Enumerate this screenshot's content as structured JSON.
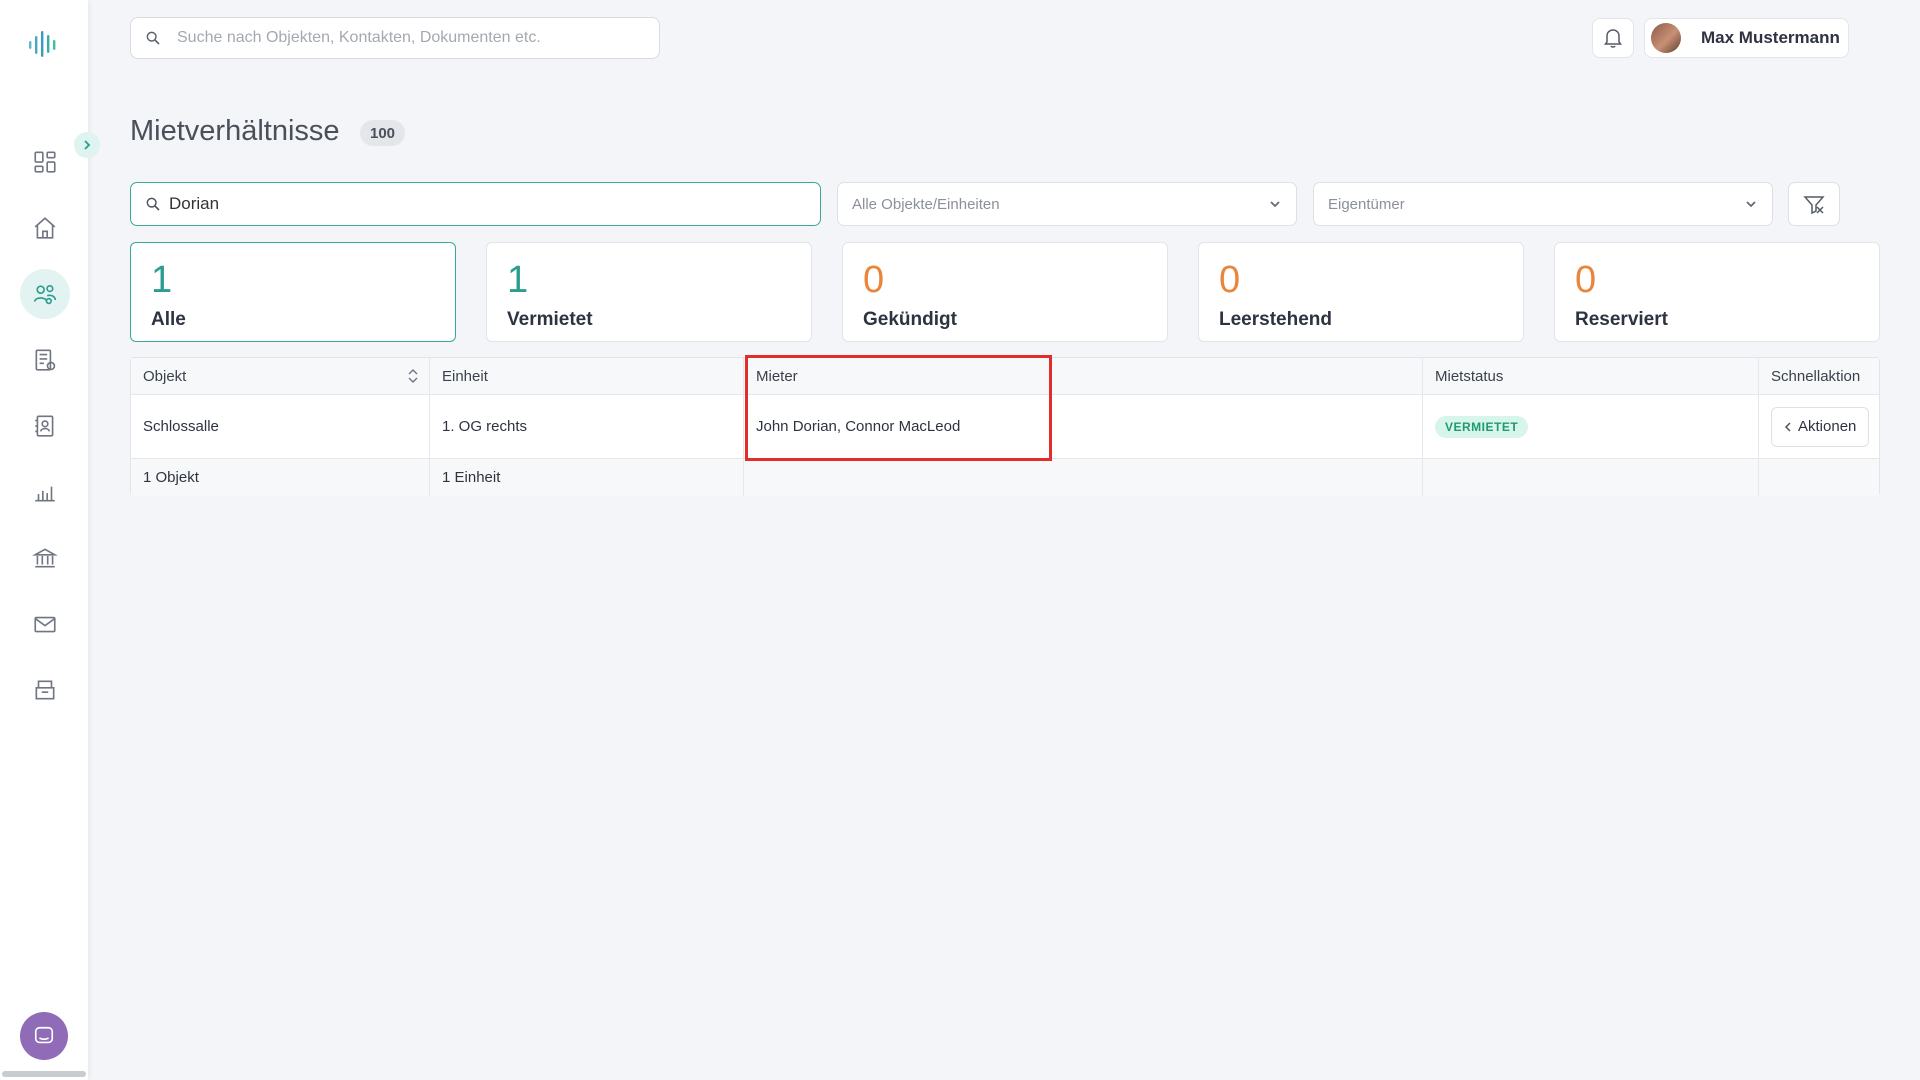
{
  "header": {
    "search_placeholder": "Suche nach Objekten, Kontakten, Dokumenten etc.",
    "user_name": "Max Mustermann"
  },
  "page": {
    "title": "Mietverhältnisse",
    "count": "100"
  },
  "filters": {
    "search_value": "Dorian",
    "objects_select": "Alle Objekte/Einheiten",
    "owner_select": "Eigentümer"
  },
  "stats": [
    {
      "value": "1",
      "label": "Alle",
      "color": "#2a9d8f"
    },
    {
      "value": "1",
      "label": "Vermietet",
      "color": "#2a9d8f"
    },
    {
      "value": "0",
      "label": "Gekündigt",
      "color": "#e8863b"
    },
    {
      "value": "0",
      "label": "Leerstehend",
      "color": "#e8863b"
    },
    {
      "value": "0",
      "label": "Reserviert",
      "color": "#e8863b"
    }
  ],
  "table": {
    "columns": [
      "Objekt",
      "Einheit",
      "Mieter",
      "Mietstatus",
      "Schnellaktion"
    ],
    "rows": [
      {
        "objekt": "Schlossalle",
        "einheit": "1. OG rechts",
        "mieter": "John Dorian, Connor MacLeod",
        "status": "VERMIETET",
        "action": "Aktionen"
      }
    ],
    "footer": {
      "objekt": "1 Objekt",
      "einheit": "1 Einheit"
    }
  },
  "colors": {
    "accent": "#2a9d8f",
    "orange": "#e8863b",
    "highlight": "#e22d2d",
    "status_bg": "#d7f5ea"
  },
  "icons": {
    "sidebar": [
      "dashboard-icon",
      "home-icon",
      "tenants-icon",
      "documents-icon",
      "contacts-icon",
      "reports-icon",
      "bank-icon",
      "mail-icon",
      "archive-icon"
    ]
  }
}
